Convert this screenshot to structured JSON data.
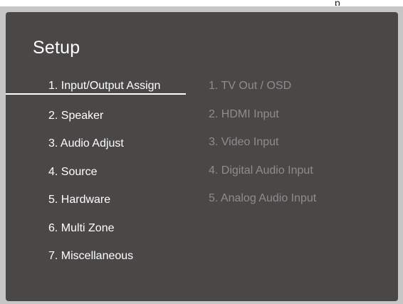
{
  "top_fragment": "p",
  "title": "Setup",
  "menu": {
    "items": [
      {
        "label": "1. Input/Output Assign"
      },
      {
        "label": "2. Speaker"
      },
      {
        "label": "3. Audio Adjust"
      },
      {
        "label": "4. Source"
      },
      {
        "label": "5. Hardware"
      },
      {
        "label": "6. Multi Zone"
      },
      {
        "label": "7. Miscellaneous"
      }
    ],
    "selected_index": 0
  },
  "submenu": {
    "items": [
      {
        "label": "1. TV Out / OSD"
      },
      {
        "label": "2. HDMI Input"
      },
      {
        "label": "3. Video Input"
      },
      {
        "label": "4. Digital Audio Input"
      },
      {
        "label": "5. Analog Audio Input"
      }
    ]
  },
  "colors": {
    "screen_background": "#4a4747",
    "bezel": "#c6c6c6",
    "active_text": "#ffffff",
    "inactive_text": "#8e8c8c"
  }
}
